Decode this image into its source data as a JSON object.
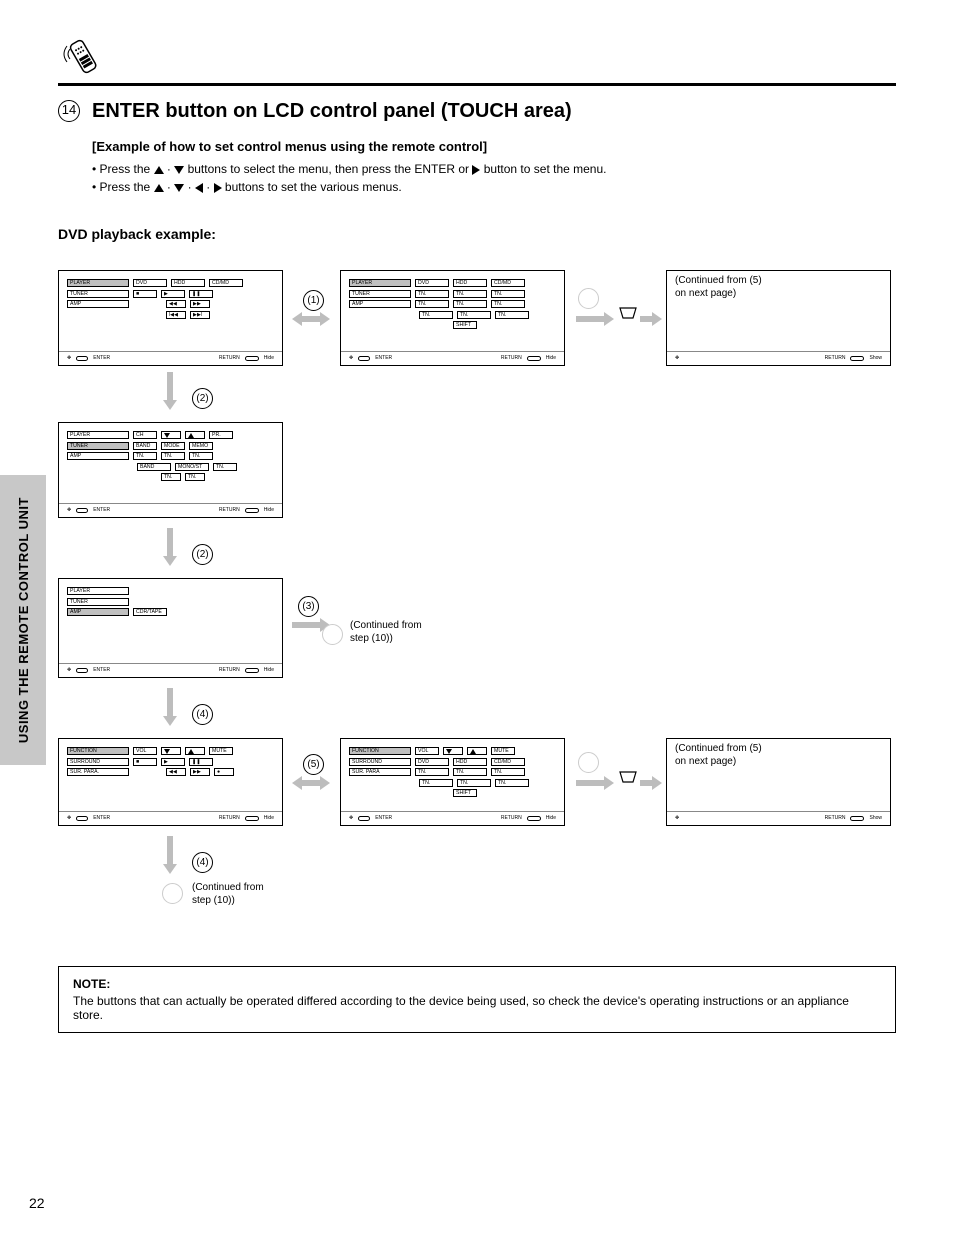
{
  "header": {
    "step_number": "14",
    "title": "ENTER button on LCD control panel (TOUCH area)",
    "subtitle": "[Example of how to set control menus using the remote control]",
    "body_before_arrows": "• Press the ",
    "body_mid1": " buttons to select the menu, then press the ENTER or ",
    "body_mid2": " button to set the menu.",
    "body_line2a": "• Press the ",
    "body_line2b": " buttons to set the various menus."
  },
  "section_label": "DVD playback example:",
  "sidebar_label": "USING THE REMOTE CONTROL UNIT",
  "panels": {
    "dvd1": {
      "footer": {
        "enter": "ENTER",
        "return": "RETURN",
        "toggle": "Hide"
      },
      "rows": [
        [
          "PLAYER",
          "DVD",
          "HDD",
          "CD/MD"
        ],
        [
          "TUNER"
        ],
        [
          "AMP"
        ]
      ],
      "r1": [
        "PLAYER",
        "DVD",
        "HDD",
        "CD/MD"
      ],
      "r2_l": "TUNER",
      "r3_l": "AMP"
    },
    "dvd2": {
      "footer": {
        "enter": "ENTER",
        "return": "RETURN",
        "toggle": "Hide"
      },
      "r1": [
        "PLAYER",
        "DVD",
        "HDD",
        "CD/MD"
      ],
      "r2": [
        "TUNER",
        "TN.",
        "TN.",
        "TN."
      ],
      "r3": [
        "AMP",
        "TN.",
        "TN.",
        "TN."
      ],
      "r4": [
        "TN.",
        "TN.",
        "TN."
      ],
      "r5": [
        "SHIFT"
      ]
    },
    "blank1": {
      "footer": {
        "return": "RETURN",
        "toggle": "Show"
      }
    },
    "panel3": {
      "footer": {
        "enter": "ENTER",
        "return": "RETURN",
        "toggle": "Hide"
      },
      "r1": [
        "PLAYER",
        "CH",
        "PR."
      ],
      "r2": [
        "TUNER",
        "BAND",
        "MODE",
        "MEMO"
      ],
      "r3": [
        "AMP",
        "TN.",
        "TN.",
        "TN."
      ],
      "r4": [
        "BAND",
        "MONO/ST",
        "TN."
      ],
      "r5": [
        "TN.",
        "TN."
      ]
    },
    "panel4": {
      "footer": {
        "enter": "ENTER",
        "return": "RETURN",
        "toggle": "Hide"
      },
      "r1_l": "PLAYER",
      "r2_l": "TUNER",
      "r3": [
        "AMP",
        "CDR/TAPE"
      ]
    },
    "panel5": {
      "footer": {
        "enter": "ENTER",
        "return": "RETURN",
        "toggle": "Hide"
      },
      "r1": [
        "FUNCTION",
        "VOL",
        "VOL",
        "MUTE"
      ],
      "r2": [
        "SURROUND"
      ],
      "r3": [
        "SUR. PARA."
      ]
    },
    "panel6": {
      "footer": {
        "enter": "ENTER",
        "return": "RETURN",
        "toggle": "Hide"
      },
      "r1": [
        "FUNCTION",
        "VOL",
        "VOL",
        "MUTE"
      ],
      "r2": [
        "SURROUND",
        "DVD",
        "HDD",
        "CD/MD"
      ],
      "r3": [
        "SUR. PARA",
        "TN.",
        "TN.",
        "TN."
      ],
      "r4": [
        "TN.",
        "TN.",
        "TN."
      ],
      "r5": [
        "SHIFT"
      ]
    },
    "blank2": {
      "footer": {
        "return": "RETURN",
        "toggle": "Show"
      }
    }
  },
  "annot": {
    "a1": "(1)",
    "b2": "(2)",
    "c3": "(3)",
    "d4": "(4)",
    "e5": "(5)",
    "cont1": "(Continued from (5)\non next page)",
    "cont2": "(Continued from (5)\non next page)",
    "cont3": "(Continued from\nstep (10))",
    "cont4": "(Continued from\nstep (10))"
  },
  "note": {
    "title": "NOTE:",
    "body": "The buttons that can actually be operated differed according to the device being used, so check the device's operating instructions or an appliance store."
  },
  "page_number": "22"
}
